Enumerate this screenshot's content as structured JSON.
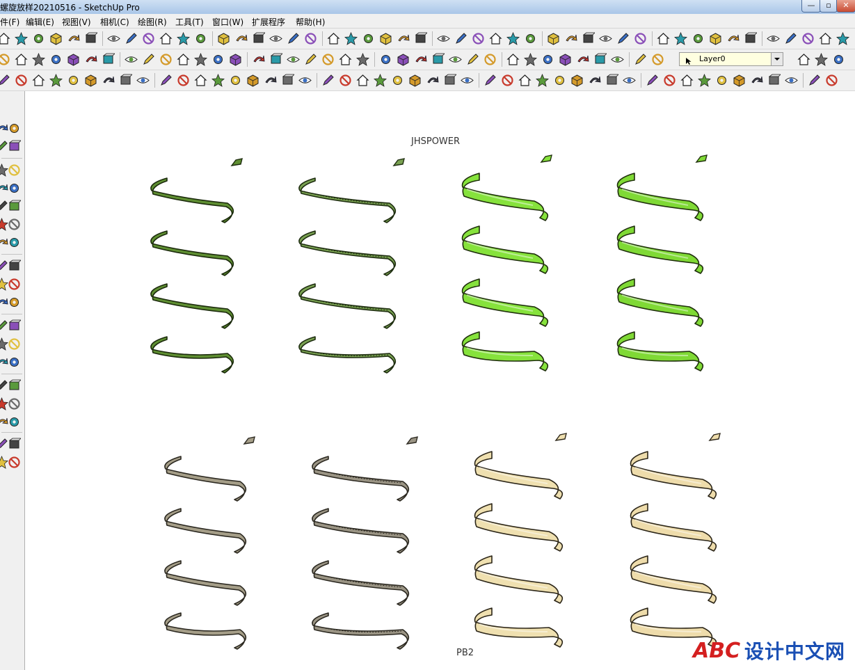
{
  "window": {
    "title": "螺旋放样20210516 - SketchUp Pro",
    "controls": [
      "—",
      "▫",
      "✕"
    ]
  },
  "menu": [
    {
      "label": "文件(F)"
    },
    {
      "label": "编辑(E)"
    },
    {
      "label": "视图(V)"
    },
    {
      "label": "相机(C)"
    },
    {
      "label": "绘图(R)"
    },
    {
      "label": "工具(T)"
    },
    {
      "label": "窗口(W)"
    },
    {
      "label": "扩展程序"
    },
    {
      "label": "帮助(H)"
    }
  ],
  "layers": {
    "current": "Layer0"
  },
  "scene": {
    "top_label": "JHSPOWER",
    "bottom_label": "PB2",
    "groups": [
      {
        "style": "dark-green",
        "fill": "#5f8f32",
        "stroke": "#1b2a0c"
      },
      {
        "style": "green-hatched",
        "fill": "#7aa252",
        "stroke": "#1e2d10"
      },
      {
        "style": "bright-green",
        "fill": "#86e23c",
        "stroke": "#1f2f0c"
      },
      {
        "style": "bright-green",
        "fill": "#7fd935",
        "stroke": "#1f2f0c"
      },
      {
        "style": "grey-brown",
        "fill": "#a59e88",
        "stroke": "#2b2820"
      },
      {
        "style": "grey-hatched",
        "fill": "#9a9484",
        "stroke": "#2b2820"
      },
      {
        "style": "cream",
        "fill": "#efe0b0",
        "stroke": "#2b2518"
      },
      {
        "style": "cream",
        "fill": "#eedcab",
        "stroke": "#2b2518"
      }
    ]
  },
  "watermark": {
    "logo_text": "ABC",
    "text": "设计中文网",
    "color": "#1a4fb4",
    "logo_color": "#d42020"
  }
}
